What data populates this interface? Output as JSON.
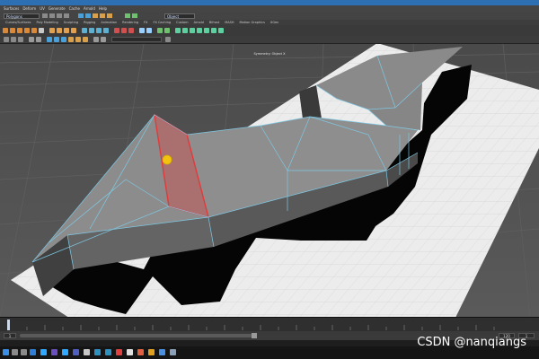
{
  "app": {
    "menus": [
      "Surfaces",
      "Deform",
      "UV",
      "Generate",
      "Cache",
      "Arnold",
      "Help"
    ],
    "workspace_value": "Polygons",
    "target_value": "Object",
    "shelf_tabs": [
      "Curves/Surfaces",
      "Poly Modeling",
      "Sculpting",
      "Rigging",
      "Animation",
      "Rendering",
      "FX",
      "FX Caching",
      "Custom",
      "Arnold",
      "Bifrost",
      "MASH",
      "Motion Graphics",
      "XGen"
    ],
    "camera_label": "Symmetry: Object X"
  },
  "timeline": {
    "range_start": "1",
    "range_end": "120",
    "current_frame": "1"
  },
  "colors": {
    "selection_red": "#e23a3a",
    "wire_cyan": "#7ec8e3",
    "accent_blue": "#2c6fb3"
  },
  "watermark": "CSDN @nanqiangs"
}
